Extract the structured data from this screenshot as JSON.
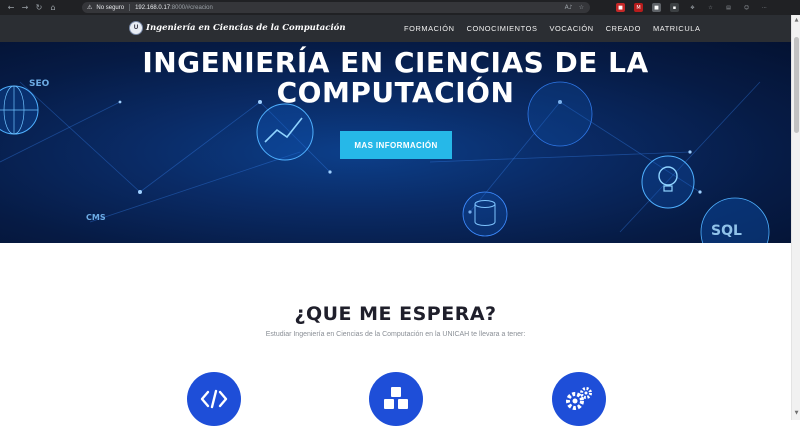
{
  "browser": {
    "security_label": "No seguro",
    "url_host": "192.168.0.17",
    "url_path": ":8000/#creacion"
  },
  "site": {
    "brand": "Ingeniería en Ciencias de la Computación",
    "nav": [
      "FORMACIÓN",
      "CONOCIMIENTOS",
      "VOCACIÓN",
      "CREADO",
      "MATRICULA"
    ]
  },
  "hero": {
    "title_line1": "INGENIERÍA EN CIENCIAS DE LA",
    "title_line2": "COMPUTACIÓN",
    "button_label": "MAS INFORMACIÓN",
    "tags": [
      "SEO",
      "CMS",
      "SQL"
    ]
  },
  "section": {
    "title": "¿QUE ME ESPERA?",
    "subtitle": "Estudiar Ingeniería en Ciencias de la Computación en la UNICAH te llevara a tener:",
    "feature_icons": [
      "code-icon",
      "cubes-icon",
      "gears-icon"
    ]
  },
  "colors": {
    "accent": "#26b8e8",
    "feature_circle": "#1e4ed8",
    "header_bg": "#2b2e33"
  }
}
